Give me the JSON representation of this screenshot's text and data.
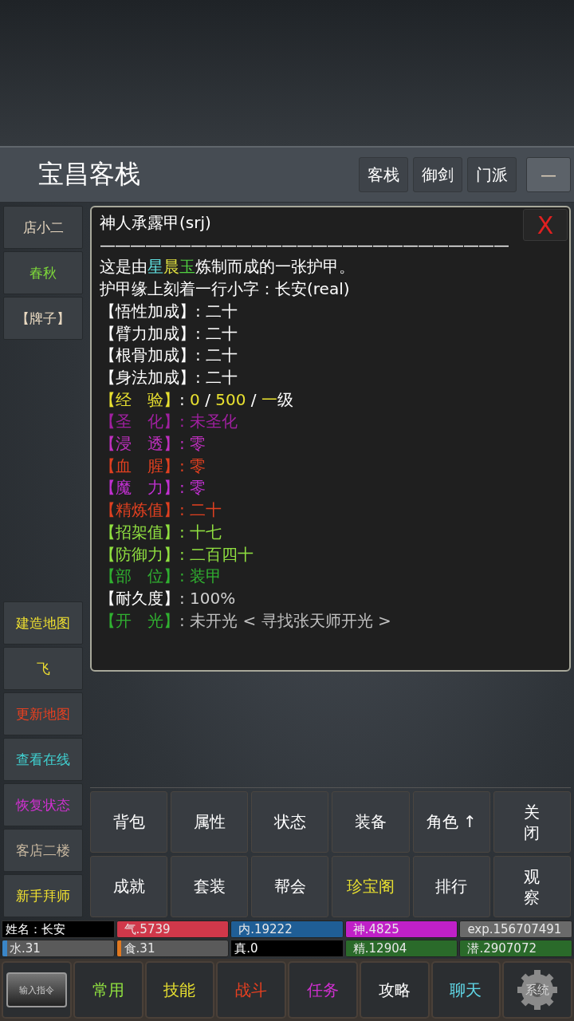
{
  "header": {
    "title": "宝昌客栈",
    "tabs": [
      "客栈",
      "御剑",
      "门派"
    ],
    "minimize": "—"
  },
  "sidebar": {
    "top": [
      {
        "label": "店小二",
        "color": "#e8d8c0"
      },
      {
        "label": "春秋",
        "color": "#7fdc3a"
      },
      {
        "label": "【牌子】",
        "color": "#e8d8c0"
      }
    ],
    "bottom": [
      {
        "label": "建造地图",
        "color": "#f0e030"
      },
      {
        "label": "飞",
        "color": "#f0e030"
      },
      {
        "label": "更新地图",
        "color": "#e84020"
      },
      {
        "label": "查看在线",
        "color": "#40d0d0"
      },
      {
        "label": "恢复状态",
        "color": "#d030d0"
      },
      {
        "label": "客店二楼",
        "color": "#c8b8a0"
      },
      {
        "label": "新手拜师",
        "color": "#f0e030"
      }
    ]
  },
  "item": {
    "title": "神人承露甲(srj)",
    "close": "X",
    "divider": "———————————————————————————",
    "lines": [
      {
        "segments": [
          {
            "text": "这是由",
            "color": "#ffffff"
          },
          {
            "text": "星",
            "color": "#60e0e0"
          },
          {
            "text": "晨",
            "color": "#e0e040"
          },
          {
            "text": "玉",
            "color": "#50d040"
          },
          {
            "text": "炼制而成的一张护甲。",
            "color": "#ffffff"
          }
        ]
      },
      {
        "segments": [
          {
            "text": "护甲缘上刻着一行小字：长安(real)",
            "color": "#ffffff"
          }
        ]
      },
      {
        "segments": [
          {
            "text": "【悟性加成】: 二十",
            "color": "#ffffff"
          }
        ]
      },
      {
        "segments": [
          {
            "text": "【臂力加成】: 二十",
            "color": "#ffffff"
          }
        ]
      },
      {
        "segments": [
          {
            "text": "【根骨加成】: 二十",
            "color": "#ffffff"
          }
        ]
      },
      {
        "segments": [
          {
            "text": "【身法加成】: 二十",
            "color": "#ffffff"
          }
        ]
      },
      {
        "segments": [
          {
            "text": "【经　验】",
            "color": "#e8e030"
          },
          {
            "text": ": ",
            "color": "#ffffff"
          },
          {
            "text": "0",
            "color": "#e8e030"
          },
          {
            "text": " / ",
            "color": "#ffffff"
          },
          {
            "text": "500",
            "color": "#e8e030"
          },
          {
            "text": " / ",
            "color": "#ffffff"
          },
          {
            "text": "一",
            "color": "#e8e030"
          },
          {
            "text": "级",
            "color": "#ffffff"
          }
        ]
      },
      {
        "segments": [
          {
            "text": "【圣　化】: 未圣化",
            "color": "#a020a0"
          }
        ]
      },
      {
        "segments": [
          {
            "text": "【浸　透】: 零",
            "color": "#c030c0"
          }
        ]
      },
      {
        "segments": [
          {
            "text": "【血　腥】: 零",
            "color": "#e04020"
          }
        ]
      },
      {
        "segments": [
          {
            "text": "【魔　力】: 零",
            "color": "#c030d0"
          }
        ]
      },
      {
        "segments": [
          {
            "text": "【精炼值】: 二十",
            "color": "#e04020"
          }
        ]
      },
      {
        "segments": [
          {
            "text": "【招架值】: 十七",
            "color": "#90e040"
          }
        ]
      },
      {
        "segments": [
          {
            "text": "【防御力】: 二百四十",
            "color": "#90e040"
          }
        ]
      },
      {
        "segments": [
          {
            "text": "【部　位】: 装甲",
            "color": "#30b030"
          }
        ]
      },
      {
        "segments": [
          {
            "text": "【耐久度】",
            "color": "#ffffff"
          },
          {
            "text": ": 100%",
            "color": "#d0d0d0"
          }
        ]
      },
      {
        "segments": [
          {
            "text": "【开　光】",
            "color": "#30b030"
          },
          {
            "text": ": 未开光 < 寻找张天师开光 >",
            "color": "#c0c0c0"
          }
        ]
      }
    ]
  },
  "actions": [
    {
      "label": "背包",
      "color": "#ffffff"
    },
    {
      "label": "属性",
      "color": "#ffffff"
    },
    {
      "label": "状态",
      "color": "#ffffff"
    },
    {
      "label": "装备",
      "color": "#ffffff"
    },
    {
      "label": "角色 ↑",
      "color": "#ffffff"
    },
    {
      "label": "关闭",
      "color": "#ffffff"
    },
    {
      "label": "成就",
      "color": "#ffffff"
    },
    {
      "label": "套装",
      "color": "#ffffff"
    },
    {
      "label": "帮会",
      "color": "#ffffff"
    },
    {
      "label": "珍宝阁",
      "color": "#e8e030"
    },
    {
      "label": "排行",
      "color": "#ffffff"
    },
    {
      "label": "观察",
      "color": "#ffffff"
    }
  ],
  "stats": [
    {
      "kind": "name",
      "label": "姓名：长安"
    },
    {
      "kind": "bar",
      "label": "气.5739",
      "color": "#d0384a",
      "level": 1
    },
    {
      "kind": "bar",
      "label": "内.19222",
      "color": "#1f5e96",
      "level": 1
    },
    {
      "kind": "bar",
      "label": "神.4825",
      "color": "#c020c8",
      "level": 1
    },
    {
      "kind": "bar",
      "label": "exp.156707491",
      "color": "#6a6a6a",
      "level": 1
    },
    {
      "kind": "bar",
      "label": "水.31",
      "color": "#3a86c8",
      "level": 0.04
    },
    {
      "kind": "bar",
      "label": "食.31",
      "color": "#e07820",
      "level": 0.04
    },
    {
      "kind": "name",
      "label": "真.0"
    },
    {
      "kind": "bar",
      "label": "精.12904",
      "color": "#2a6a2a",
      "level": 1
    },
    {
      "kind": "bar",
      "label": "潜.2907072",
      "color": "#2a6a2a",
      "level": 1
    }
  ],
  "menu": [
    {
      "kind": "command",
      "label": "输入指令"
    },
    {
      "kind": "text",
      "label": "常用",
      "color": "#90e040"
    },
    {
      "kind": "text",
      "label": "技能",
      "color": "#e8e030"
    },
    {
      "kind": "text",
      "label": "战斗",
      "color": "#e84020"
    },
    {
      "kind": "text",
      "label": "任务",
      "color": "#d030d0"
    },
    {
      "kind": "text",
      "label": "攻略",
      "color": "#ffffff"
    },
    {
      "kind": "text",
      "label": "聊天",
      "color": "#60d8e8"
    },
    {
      "kind": "gear",
      "label": "系统"
    }
  ]
}
